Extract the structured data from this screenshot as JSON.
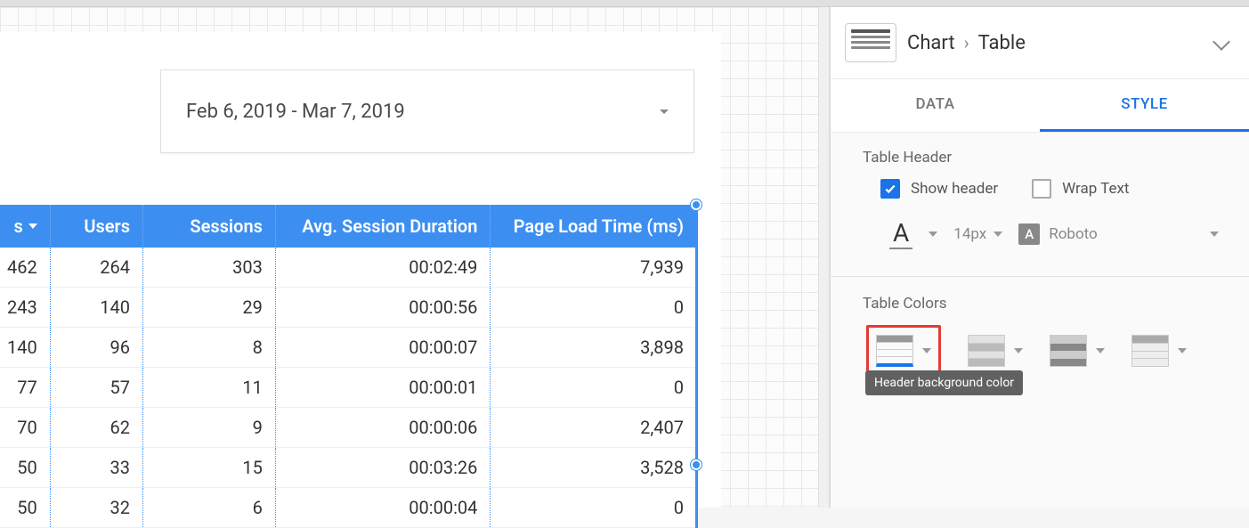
{
  "date_range": "Feb 6, 2019 - Mar 7, 2019",
  "table": {
    "headers": [
      "s",
      "Users",
      "Sessions",
      "Avg. Session Duration",
      "Page Load Time (ms)"
    ],
    "rows": [
      [
        "462",
        "264",
        "303",
        "00:02:49",
        "7,939"
      ],
      [
        "243",
        "140",
        "29",
        "00:00:56",
        "0"
      ],
      [
        "140",
        "96",
        "8",
        "00:00:07",
        "3,898"
      ],
      [
        "77",
        "57",
        "11",
        "00:00:01",
        "0"
      ],
      [
        "70",
        "62",
        "9",
        "00:00:06",
        "2,407"
      ],
      [
        "50",
        "33",
        "15",
        "00:03:26",
        "3,528"
      ],
      [
        "50",
        "32",
        "6",
        "00:00:04",
        "0"
      ]
    ]
  },
  "sidebar": {
    "breadcrumb": {
      "root": "Chart",
      "leaf": "Table"
    },
    "tabs": {
      "data": "DATA",
      "style": "STYLE"
    },
    "sections": {
      "table_header": {
        "title": "Table Header",
        "show_header": "Show header",
        "wrap_text": "Wrap Text",
        "font_size": "14px",
        "font_family": "Roboto"
      },
      "table_colors": {
        "title": "Table Colors",
        "tooltip": "Header background color"
      }
    }
  },
  "chart_data": {
    "type": "table",
    "columns": [
      "s",
      "Users",
      "Sessions",
      "Avg. Session Duration",
      "Page Load Time (ms)"
    ],
    "rows": [
      [
        462,
        264,
        303,
        "00:02:49",
        7939
      ],
      [
        243,
        140,
        29,
        "00:00:56",
        0
      ],
      [
        140,
        96,
        8,
        "00:00:07",
        3898
      ],
      [
        77,
        57,
        11,
        "00:00:01",
        0
      ],
      [
        70,
        62,
        9,
        "00:00:06",
        2407
      ],
      [
        50,
        33,
        15,
        "00:03:26",
        3528
      ],
      [
        50,
        32,
        6,
        "00:00:04",
        0
      ]
    ],
    "title": "",
    "date_range": "Feb 6, 2019 - Mar 7, 2019"
  }
}
